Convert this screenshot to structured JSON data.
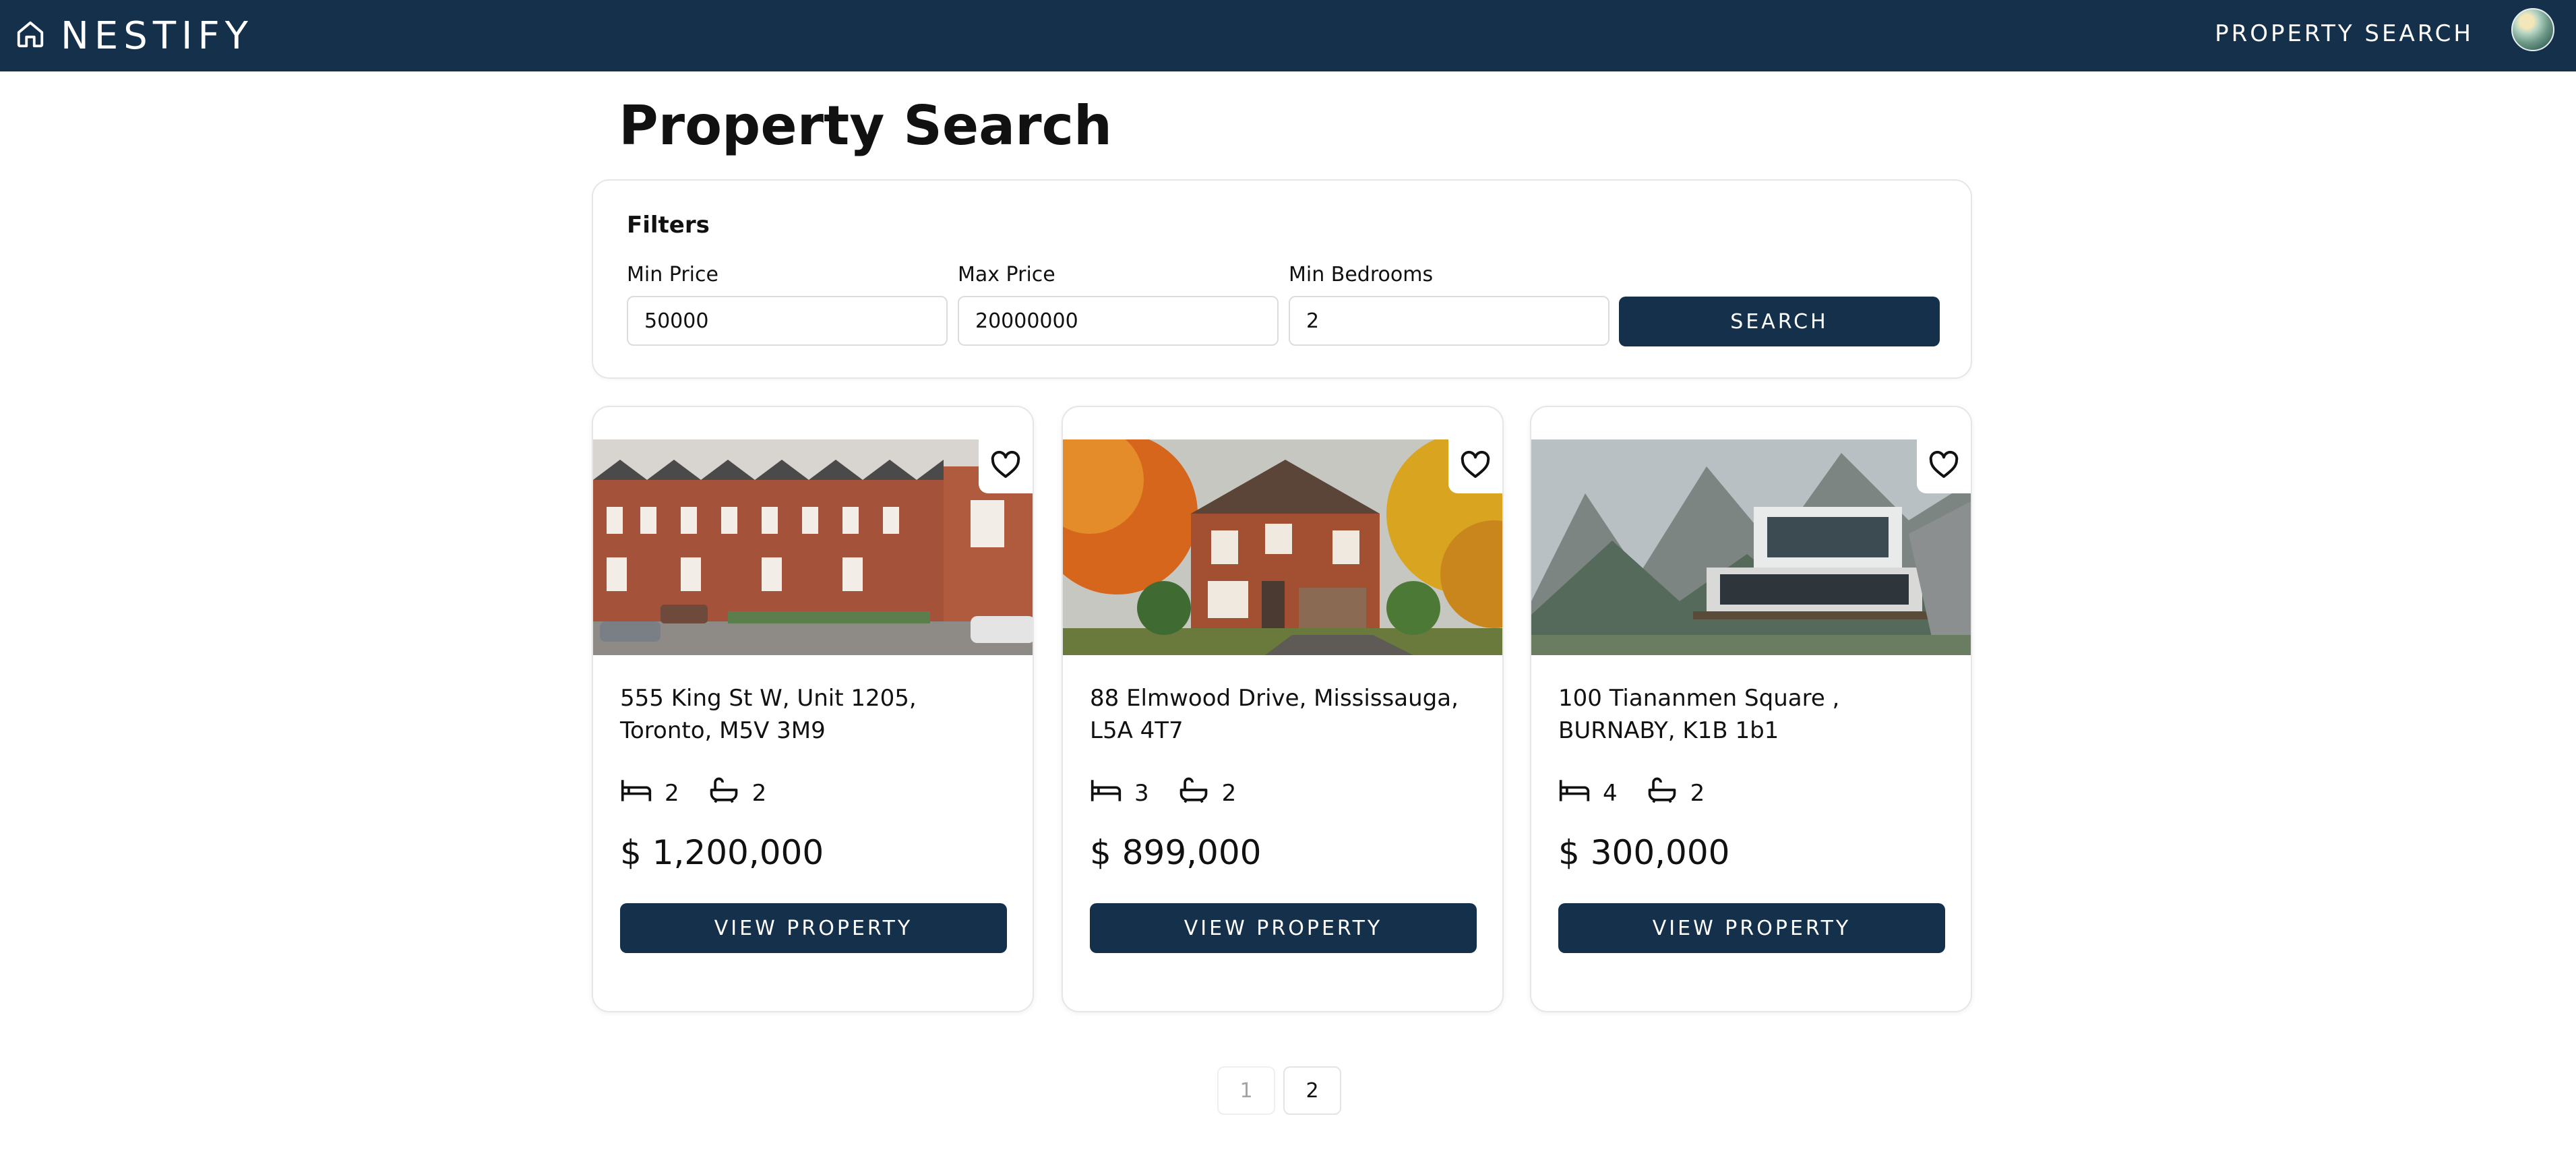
{
  "header": {
    "brand": "NESTIFY",
    "nav_link": "PROPERTY SEARCH",
    "logo_icon": "home-icon",
    "avatar_icon": "user-avatar"
  },
  "page": {
    "title": "Property Search"
  },
  "filters": {
    "title": "Filters",
    "min_price_label": "Min Price",
    "min_price_value": "50000",
    "max_price_label": "Max Price",
    "max_price_value": "20000000",
    "min_bedrooms_label": "Min Bedrooms",
    "min_bedrooms_value": "2",
    "search_label": "SEARCH"
  },
  "listings": [
    {
      "address": "555 King St W, Unit 1205, Toronto, M5V 3M9",
      "beds": "2",
      "baths": "2",
      "price": "$ 1,200,000",
      "button": "VIEW PROPERTY",
      "image": "brick row houses street"
    },
    {
      "address": "88 Elmwood Drive, Mississauga, L5A 4T7",
      "beds": "3",
      "baths": "2",
      "price": "$ 899,000",
      "button": "VIEW PROPERTY",
      "image": "brick house autumn trees"
    },
    {
      "address": "100 Tiananmen Square , BURNABY, K1B 1b1",
      "beds": "4",
      "baths": "2",
      "price": "$ 300,000",
      "button": "VIEW PROPERTY",
      "image": "modern house mountains"
    }
  ],
  "pagination": {
    "pages": [
      "1",
      "2"
    ],
    "current": "1"
  },
  "colors": {
    "primary": "#14304b",
    "border": "#e6e6e6",
    "background": "#ffffff"
  }
}
